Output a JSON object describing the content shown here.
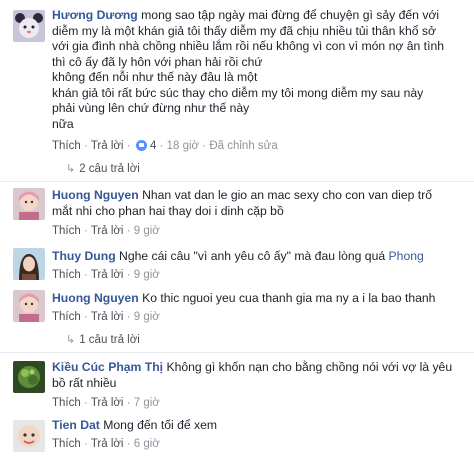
{
  "comments": [
    {
      "author": "Hương Dương",
      "text": "mong sao tập ngày mai đừng để chuyện gì sảy đến với\ndiễm my là một khán giả tôi thấy diễm my đã chịu nhiều tủi thân khổ sở\nvới gia đình nhà chồng nhiều lắm rồi nếu không vì con vì món nợ ân tình\nthì cô ấy đã ly hôn với phan hải rồi chứ\nkhông đến nỗi như thế này đâu là một\nkhán giả tôi rất bức súc thay cho diễm my tôi mong diễm my sau này\nphải vùng lên chứ đừng như thế này\nnữa",
      "like": "Thích",
      "reply": "Trả lời",
      "reaction_count": "4",
      "time": "18 giờ",
      "edited": "Đã chỉnh sửa",
      "replies_label": "2 câu trả lời"
    },
    {
      "author": "Huong Nguyen",
      "text": "Nhan vat dan le gio an mac sexy cho con van diep trố\nmắt nhi cho phan hai thay doi i dinh cặp bồ",
      "like": "Thích",
      "reply": "Trả lời",
      "time": "9 giờ"
    },
    {
      "author": "Thuy Dung",
      "text_before": "Nghe cái câu \"vì anh yêu cô ấy\" mà đau lòng quá",
      "mention": "Phong",
      "like": "Thích",
      "reply": "Trả lời",
      "time": "9 giờ"
    },
    {
      "author": "Huong Nguyen",
      "text": "Ko thic nguoi yeu cua thanh gia ma ny a i la bao thanh",
      "like": "Thích",
      "reply": "Trả lời",
      "time": "9 giờ",
      "replies_label": "1 câu trả lời"
    },
    {
      "author": "Kiều Cúc Phạm Thị",
      "text": "Không gì khốn nạn cho bằng chồng nói với vợ là yêu\nbồ rất nhiều",
      "like": "Thích",
      "reply": "Trả lời",
      "time": "7 giờ"
    },
    {
      "author": "Tien Dat",
      "text": "Mong đến tối để xem",
      "like": "Thích",
      "reply": "Trả lời",
      "time": "6 giờ"
    }
  ],
  "separator": "·"
}
